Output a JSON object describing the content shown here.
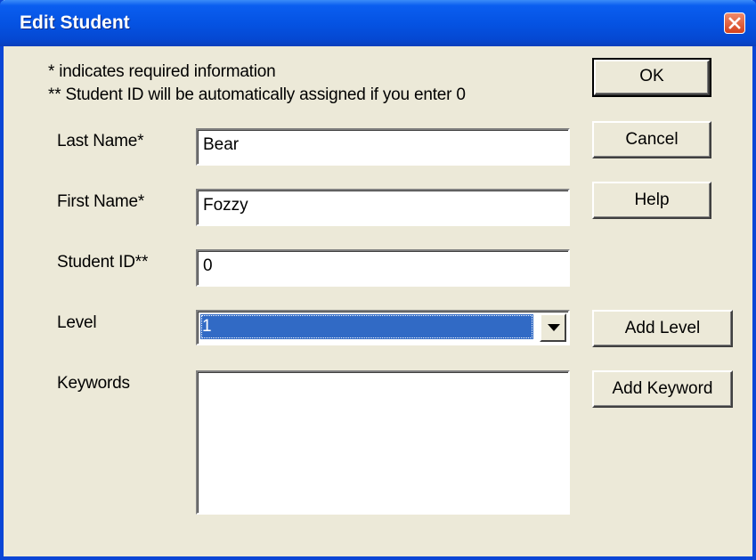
{
  "window": {
    "title": "Edit Student",
    "close_icon": "close-icon"
  },
  "info": {
    "line1": "* indicates required information",
    "line2": "** Student ID will be automatically assigned if you enter 0"
  },
  "form": {
    "last_name": {
      "label": "Last Name*",
      "value": "Bear"
    },
    "first_name": {
      "label": "First Name*",
      "value": "Fozzy"
    },
    "student_id": {
      "label": "Student ID**",
      "value": "0"
    },
    "level": {
      "label": "Level",
      "value": "1"
    },
    "keywords": {
      "label": "Keywords",
      "value": ""
    }
  },
  "buttons": {
    "ok": "OK",
    "cancel": "Cancel",
    "help": "Help",
    "add_level": "Add Level",
    "add_keyword": "Add Keyword"
  },
  "colors": {
    "titlebar": "#0553e3",
    "dialog_bg": "#ece9d8",
    "selection": "#316ac5",
    "close": "#d4411c"
  }
}
